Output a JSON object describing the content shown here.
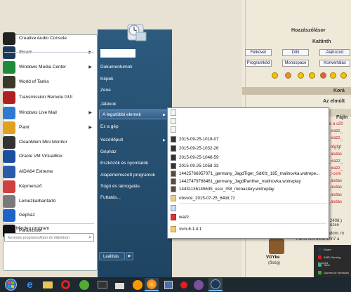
{
  "background_page": {
    "heading": "Hozzászólásor",
    "subheading": "Kattinth",
    "buttons_row1": [
      "Félkövér",
      "Dőlt",
      "Aláhúzott"
    ],
    "buttons_row2": [
      "Programkód",
      "Monospace",
      "Konvertálás"
    ],
    "bar1": "Korá",
    "bar2": "Az elmúlt",
    "col_header": "Fájln",
    "file_rows": [
      "tése a s20",
      "31_wazz_",
      "31_wazz_",
      "31_bfgfgf",
      "31_asdas",
      "31_wazz_",
      "31_wazz_",
      "31_l-com",
      "31_asdas",
      "31_asdas",
      "31_asdas",
      "31_asdas"
    ],
    "snippet1": "2408.) üzen",
    "snippet2": "tudom: m",
    "snippet3": "menü hint Most Win7 a",
    "user_name": "VGYke",
    "user_status": "(őség)"
  },
  "taskbar_popup": {
    "rows": [
      "Share",
      "AMD Gaming Evolved",
      "Sikfu",
      "Games for Windows Marketplace"
    ]
  },
  "start_menu": {
    "left_items": [
      {
        "label": "Creative Audio Console",
        "icon": "creative-audio-icon",
        "color": "#222222",
        "arrow": false
      },
      {
        "label": "Steam",
        "icon": "steam-icon",
        "color": "#1b3a5a",
        "arrow": true
      },
      {
        "label": "Windows Media Center",
        "icon": "media-center-icon",
        "color": "#1f8a3a",
        "arrow": true
      },
      {
        "label": "World of Tanks",
        "icon": "world-of-tanks-icon",
        "color": "#3a3a2a",
        "arrow": false
      },
      {
        "label": "Transmission Remote GUI",
        "icon": "transmission-icon",
        "color": "#b02020",
        "arrow": false
      },
      {
        "label": "Windows Live Mail",
        "icon": "live-mail-icon",
        "color": "#2d7ad0",
        "arrow": true
      },
      {
        "label": "Paint",
        "icon": "paint-icon",
        "color": "#e0a020",
        "arrow": true
      },
      {
        "label": "CleanMem Mini Monitor",
        "icon": "cleanmem-icon",
        "color": "#333333",
        "arrow": false
      },
      {
        "label": "Oracle VM VirtualBox",
        "icon": "virtualbox-icon",
        "color": "#1a4fa0",
        "arrow": false
      },
      {
        "label": "AIDA64 Extreme",
        "icon": "aida64-icon",
        "color": "#2a5caa",
        "arrow": false
      },
      {
        "label": "Képmetsző",
        "icon": "snipping-tool-icon",
        "color": "#d04040",
        "arrow": false
      },
      {
        "label": "Lemezkarbantartó",
        "icon": "disk-cleanup-icon",
        "color": "#7a7a7a",
        "arrow": false
      },
      {
        "label": "Gépház",
        "icon": "settings-icon",
        "color": "#1e64c8",
        "arrow": false
      },
      {
        "label": "Parancssor",
        "icon": "command-prompt-icon",
        "color": "#111111",
        "arrow": false
      }
    ],
    "all_programs": "Minden program",
    "search_placeholder": "Keresés programokban és fájlokban",
    "right_items": {
      "user": "",
      "documents": "Dokumentumok",
      "pictures": "Képek",
      "music": "Zene",
      "games": "Játékok",
      "recent": "A legutóbbi elemek",
      "computer": "Ez a gép",
      "control_panel": "Vezérlőpult",
      "settings": "Gépház",
      "devices": "Eszközök és nyomtatók",
      "defaults": "Alapértelmezett programok",
      "help": "Súgó és támogatás",
      "run": "Futtatás..."
    },
    "shutdown": "Leállítás"
  },
  "recent_items": [
    {
      "label": "",
      "icon": "text-file-icon"
    },
    {
      "label": "",
      "icon": "text-file-icon"
    },
    {
      "label": "",
      "icon": "text-file-icon"
    },
    {
      "label": "2015-09-25-1018-07",
      "icon": "video-file-icon"
    },
    {
      "label": "2015-09-25-1032-26",
      "icon": "video-file-icon"
    },
    {
      "label": "2015-09-25-1046-59",
      "icon": "video-file-icon"
    },
    {
      "label": "2015-09-25-1058-33",
      "icon": "video-file-icon"
    },
    {
      "label": "14425766957071_germany_JagdTiger_SdKfz_185_malinovka.wotrepe...",
      "icon": "replay-file-icon"
    },
    {
      "label": "14427479768461_germany_JagdPanther_malinovka.wotreplay",
      "icon": "replay-file-icon"
    },
    {
      "label": "14431136145635_ussr_IS8_monastery.wotreplay",
      "icon": "replay-file-icon"
    },
    {
      "label": "obsvce_2015-07-25_64bit.7z",
      "icon": "archive-file-icon"
    },
    {
      "label": "",
      "icon": "image-file-icon"
    },
    {
      "label": "wazz",
      "icon": "pdf-file-icon"
    },
    {
      "label": "xvm-6.1.4.1",
      "icon": "folder-icon"
    }
  ],
  "taskbar": {
    "icons": [
      "start-orb-icon",
      "internet-explorer-icon",
      "file-explorer-icon",
      "opera-icon",
      "utorrent-icon",
      "video-player-icon",
      "clapperboard-icon",
      "aimp-icon",
      "firefox-icon",
      "floppy-icon",
      "record-icon",
      "viber-icon",
      "steam-taskbar-icon"
    ]
  }
}
